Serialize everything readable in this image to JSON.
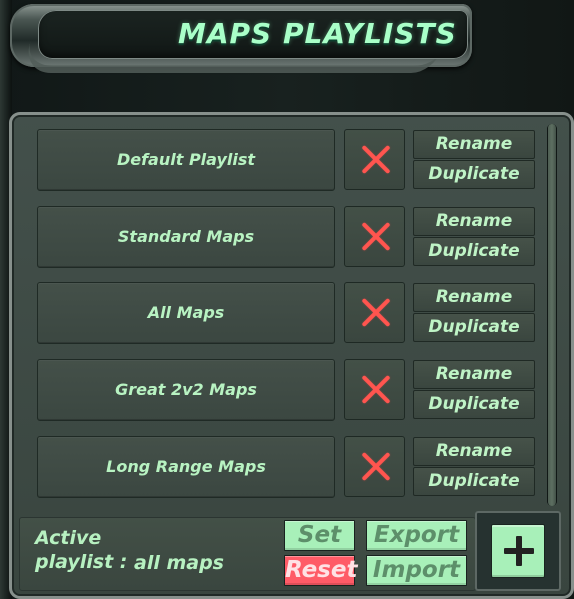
{
  "window": {
    "title": "MAPS PLAYLISTS"
  },
  "playlists": [
    {
      "name": "Default Playlist",
      "delete_icon": "close-icon",
      "rename_label": "Rename",
      "duplicate_label": "Duplicate"
    },
    {
      "name": "Standard Maps",
      "delete_icon": "close-icon",
      "rename_label": "Rename",
      "duplicate_label": "Duplicate"
    },
    {
      "name": "All Maps",
      "delete_icon": "close-icon",
      "rename_label": "Rename",
      "duplicate_label": "Duplicate"
    },
    {
      "name": "Great 2v2 Maps",
      "delete_icon": "close-icon",
      "rename_label": "Rename",
      "duplicate_label": "Duplicate"
    },
    {
      "name": "Long Range Maps",
      "delete_icon": "close-icon",
      "rename_label": "Rename",
      "duplicate_label": "Duplicate"
    }
  ],
  "footer": {
    "active_label": "Active\nplaylist :",
    "active_value": "all maps",
    "set_label": "Set",
    "reset_label": "Reset",
    "export_label": "Export",
    "import_label": "Import",
    "add_icon": "plus-icon"
  },
  "colors": {
    "panel": "#3a463f",
    "text_green": "#b8f3c2",
    "accent_green": "#a8f0b9",
    "delete_red": "#ff554f",
    "reset_red": "#ff5b67"
  }
}
